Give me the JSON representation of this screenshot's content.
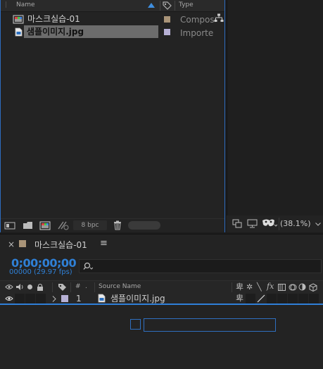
{
  "project_panel": {
    "header": {
      "name_col": "Name",
      "type_col": "Type"
    },
    "items": [
      {
        "name": "마스크실습-01",
        "type": "Composi",
        "label_color": "#a99478",
        "selected": false
      },
      {
        "name": "샘플이미지.jpg",
        "type": "Importe",
        "label_color": "#b6b0d4",
        "selected": true
      }
    ],
    "footer": {
      "bpc": "8 bpc"
    }
  },
  "viewer": {
    "zoom": "(38.1%)"
  },
  "timeline": {
    "tab_title": "마스크실습-01",
    "timecode": "0;00;00;00",
    "frames_fps": "00000 (29.97 fps)",
    "columns": {
      "number": "#",
      "source_name": "Source Name"
    },
    "layers": [
      {
        "number": "1",
        "source_name": "샘플이미지.jpg",
        "label_color": "#b6b0d4"
      }
    ]
  },
  "colors": {
    "accent": "#2f80d6",
    "selection": "#6c6c6c"
  }
}
